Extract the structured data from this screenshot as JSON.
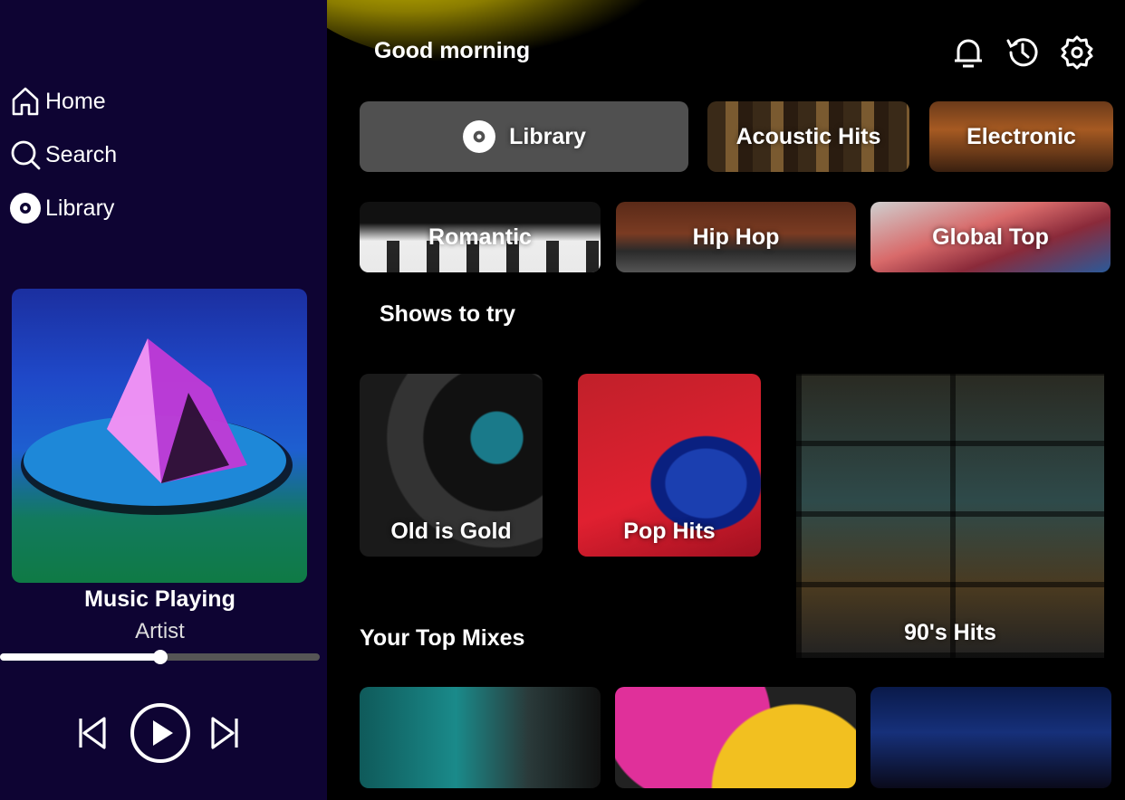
{
  "sidebar": {
    "nav": [
      {
        "label": "Home",
        "icon": "home-icon"
      },
      {
        "label": "Search",
        "icon": "search-icon"
      },
      {
        "label": "Library",
        "icon": "disc-icon"
      }
    ],
    "now_playing": {
      "title": "Music Playing",
      "artist": "Artist",
      "progress": 0.5
    },
    "controls": {
      "prev_icon": "skip-back-icon",
      "play_icon": "play-icon",
      "next_icon": "skip-forward-icon"
    },
    "background": "#0e0433"
  },
  "header": {
    "greeting": "Good morning",
    "icons": [
      "bell-icon",
      "history-icon",
      "gear-icon"
    ]
  },
  "quick_picks": [
    {
      "label": "Library",
      "icon": "disc-icon"
    },
    {
      "label": "Acoustic Hits"
    },
    {
      "label": "Electronic"
    },
    {
      "label": "Romantic"
    },
    {
      "label": "Hip Hop"
    },
    {
      "label": "Global Top"
    }
  ],
  "shows": {
    "title": "Shows to try",
    "items": [
      {
        "label": "Old is Gold"
      },
      {
        "label": "Pop Hits"
      },
      {
        "label": "90's Hits"
      }
    ]
  },
  "mixes": {
    "title": "Your Top Mixes"
  },
  "colors": {
    "accent_glow": "#d9c800",
    "library_chip": "#505050"
  }
}
